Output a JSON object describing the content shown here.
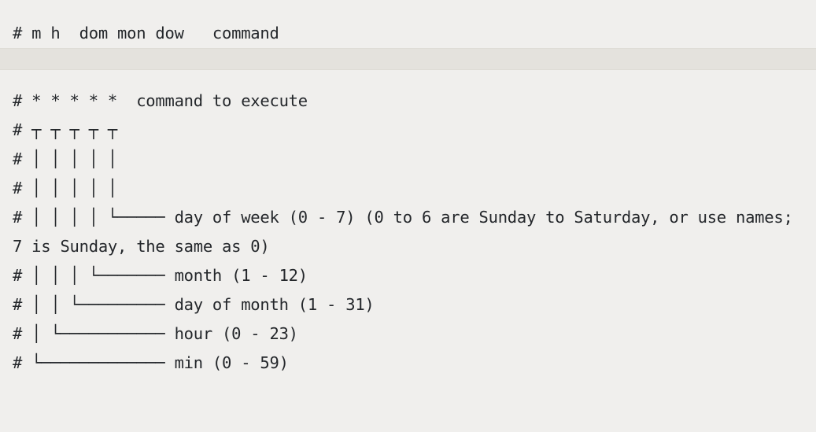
{
  "document": {
    "kind": "crontab-syntax-reference",
    "colors": {
      "page_background": "#f0efed",
      "band_background": "#e4e2dd",
      "band_border": "#dedcd6",
      "text": "#24272b"
    },
    "header_block": {
      "lines": [
        "# m h  dom mon dow   command"
      ]
    },
    "separator": {
      "label": ""
    },
    "body_block": {
      "lines": [
        "# * * * * *  command to execute",
        "# ┬ ┬ ┬ ┬ ┬",
        "# │ │ │ │ │",
        "# │ │ │ │ │",
        "# │ │ │ │ └───── day of week (0 - 7) (0 to 6 are Sunday to Saturday, or use names; 7 is Sunday, the same as 0)",
        "# │ │ │ └─────── month (1 - 12)",
        "# │ │ └───────── day of month (1 - 31)",
        "# │ └─────────── hour (0 - 23)",
        "# └───────────── min (0 - 59)"
      ]
    },
    "fields": [
      {
        "symbol": "m",
        "name": "min",
        "range": "0 - 59"
      },
      {
        "symbol": "h",
        "name": "hour",
        "range": "0 - 23"
      },
      {
        "symbol": "dom",
        "name": "day of month",
        "range": "1 - 31"
      },
      {
        "symbol": "mon",
        "name": "month",
        "range": "1 - 12"
      },
      {
        "symbol": "dow",
        "name": "day of week",
        "range": "0 - 7"
      },
      {
        "symbol": "command",
        "name": "command to execute",
        "range": ""
      }
    ],
    "notes": [
      "0 to 6 are Sunday to Saturday, or use names; 7 is Sunday, the same as 0"
    ]
  }
}
